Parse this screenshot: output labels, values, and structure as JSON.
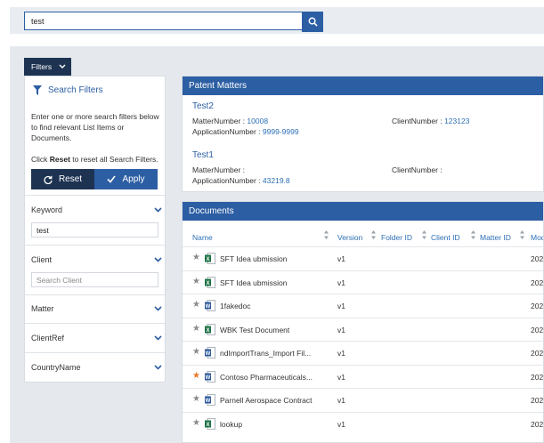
{
  "search": {
    "value": "test"
  },
  "filters_toggle": {
    "label": "Filters"
  },
  "filter_panel": {
    "title": "Search Filters",
    "description": "Enter one or more search filters below to find relevant List Items or Documents.",
    "reset_note_prefix": "Click ",
    "reset_note_bold": "Reset",
    "reset_note_suffix": " to reset all Search Filters.",
    "reset_label": "Reset",
    "apply_label": "Apply",
    "sections": {
      "keyword": {
        "label": "Keyword",
        "value": "test"
      },
      "client": {
        "label": "Client",
        "placeholder": "Search Client"
      },
      "matter": {
        "label": "Matter"
      },
      "clientref": {
        "label": "ClientRef"
      },
      "countryname": {
        "label": "CountryName"
      }
    }
  },
  "patent_matters": {
    "header": "Patent Matters",
    "items": [
      {
        "title": "Test2",
        "matter_label": "MatterNumber :",
        "matter_value": "10008",
        "app_label": "ApplicationNumber :",
        "app_value": "9999-9999",
        "client_label": "ClientNumber :",
        "client_value": "123123"
      },
      {
        "title": "Test1",
        "matter_label": "MatterNumber :",
        "matter_value": "",
        "app_label": "ApplicationNumber :",
        "app_value": "43219.8",
        "client_label": "ClientNumber :",
        "client_value": ""
      }
    ]
  },
  "documents": {
    "header": "Documents",
    "columns": {
      "name": "Name",
      "version": "Version",
      "folder_id": "Folder ID",
      "client_id": "Client ID",
      "matter_id": "Matter ID",
      "modified": "Mod"
    },
    "rows": [
      {
        "name": "SFT Idea ubmission",
        "version": "v1",
        "modified": "202",
        "fav": false,
        "type": "excel"
      },
      {
        "name": "SFT Idea ubmission",
        "version": "v1",
        "modified": "202",
        "fav": false,
        "type": "excel"
      },
      {
        "name": "1fakedoc",
        "version": "v1",
        "modified": "202",
        "fav": false,
        "type": "word"
      },
      {
        "name": "WBK Test Document",
        "version": "v1",
        "modified": "202",
        "fav": false,
        "type": "excel"
      },
      {
        "name": "ndImportTrans_Import Fil...",
        "version": "v1",
        "modified": "202",
        "fav": false,
        "type": "word"
      },
      {
        "name": "Contoso Pharmaceuticals...",
        "version": "v1",
        "modified": "202",
        "fav": true,
        "type": "word"
      },
      {
        "name": "Parnell Aerospace Contract",
        "version": "v1",
        "modified": "202",
        "fav": false,
        "type": "word"
      },
      {
        "name": "lookup",
        "version": "v1",
        "modified": "202",
        "fav": false,
        "type": "excel"
      }
    ]
  },
  "colors": {
    "primary": "#2c5ea3",
    "dark": "#1e3352",
    "link": "#2c6fb5",
    "favorite": "#e87722",
    "excel": "#1e7145",
    "word": "#2b579a"
  }
}
